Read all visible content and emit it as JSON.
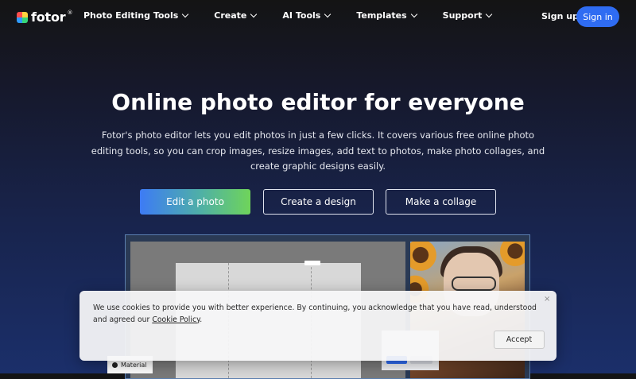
{
  "brand": {
    "name": "fotor",
    "trademark": "®",
    "logo_colors": [
      "#ff4d4d",
      "#ffd23f",
      "#2f9bff",
      "#37d67a"
    ]
  },
  "nav": {
    "items": [
      {
        "label": "Photo Editing Tools"
      },
      {
        "label": "Create"
      },
      {
        "label": "AI Tools"
      },
      {
        "label": "Templates"
      },
      {
        "label": "Support"
      }
    ],
    "signup_label": "Sign up",
    "signin_label": "Sign in"
  },
  "hero": {
    "title": "Online photo editor for everyone",
    "description": "Fotor's photo editor lets you edit photos in just a few clicks. It covers various free online photo editing tools, so you can crop images, resize images, add text to photos, make photo collages, and create graphic designs easily."
  },
  "actions": {
    "edit_label": "Edit a photo",
    "design_label": "Create a design",
    "collage_label": "Make a collage"
  },
  "preview": {
    "material_label": "Material"
  },
  "cookie": {
    "text": "We use cookies to provide you with better experience. By continuing, you acknowledge that you have read, understood and agreed our ",
    "policy_link": "Cookie Policy",
    "period": ".",
    "close": "×",
    "accept_label": "Accept"
  },
  "colors": {
    "primary": "#2f6cf2",
    "background_top": "#141414",
    "background_bottom": "#1b2f6a"
  }
}
